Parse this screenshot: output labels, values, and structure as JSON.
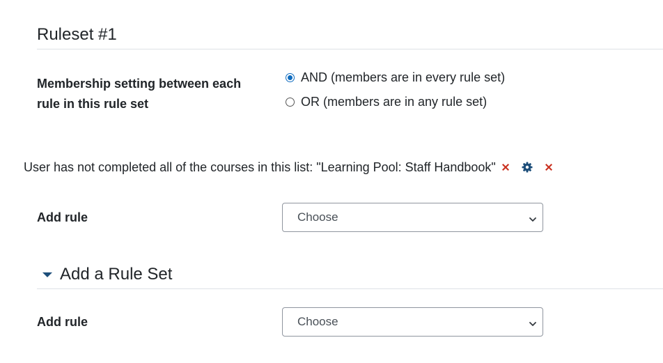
{
  "ruleset": {
    "title": "Ruleset #1",
    "membership_label": "Membership setting between each rule in this rule set",
    "options": [
      {
        "label": "AND (members are in every rule set)",
        "checked": true
      },
      {
        "label": "OR (members are in any rule set)",
        "checked": false
      }
    ],
    "rule": {
      "text": "User has not completed all of the courses in this list: \"Learning Pool: Staff Handbook\"",
      "icons": [
        "remove-item-icon",
        "settings-gear-icon",
        "delete-rule-icon"
      ]
    },
    "add_rule": {
      "label": "Add rule",
      "selected": "Choose"
    }
  },
  "add_ruleset": {
    "title": "Add a Rule Set",
    "add_rule": {
      "label": "Add rule",
      "selected": "Choose"
    }
  },
  "colors": {
    "accent": "#0f6cbf",
    "danger": "#ca3120",
    "icon_blue": "#1d4e7a",
    "text": "#212529"
  }
}
